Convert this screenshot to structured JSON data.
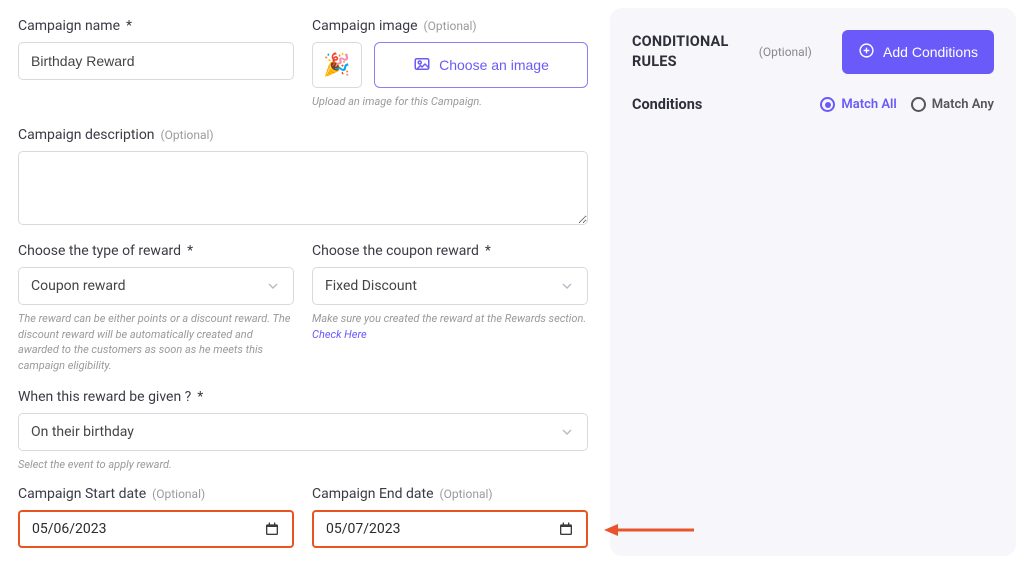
{
  "left": {
    "campaign_name": {
      "label": "Campaign name",
      "req": "*",
      "value": "Birthday Reward"
    },
    "campaign_image": {
      "label": "Campaign image",
      "optional": "(Optional)",
      "emoji": "🎉",
      "button": "Choose an image",
      "helper": "Upload an image for this Campaign."
    },
    "description": {
      "label": "Campaign description",
      "optional": "(Optional)"
    },
    "reward_type": {
      "label": "Choose the type of reward",
      "req": "*",
      "value": "Coupon reward",
      "helper": "The reward can be either points or a discount reward. The discount reward will be automatically created and awarded to the customers as soon as he meets this campaign eligibility."
    },
    "coupon_reward": {
      "label": "Choose the coupon reward",
      "req": "*",
      "value": "Fixed Discount",
      "helper": "Make sure you created the reward at the Rewards section.",
      "link_text": "Check Here"
    },
    "when_given": {
      "label": "When this reward be given ?",
      "req": "*",
      "value": "On their birthday",
      "helper": "Select the event to apply reward."
    },
    "start_date": {
      "label": "Campaign Start date",
      "optional": "(Optional)",
      "value": "05/06/2023"
    },
    "end_date": {
      "label": "Campaign End date",
      "optional": "(Optional)",
      "value": "05/07/2023"
    }
  },
  "right": {
    "title_l1": "CONDITIONAL",
    "title_l2": "RULES",
    "optional": "(Optional)",
    "add_conditions": "Add Conditions",
    "conditions_label": "Conditions",
    "match_all": "Match All",
    "match_any": "Match Any"
  }
}
